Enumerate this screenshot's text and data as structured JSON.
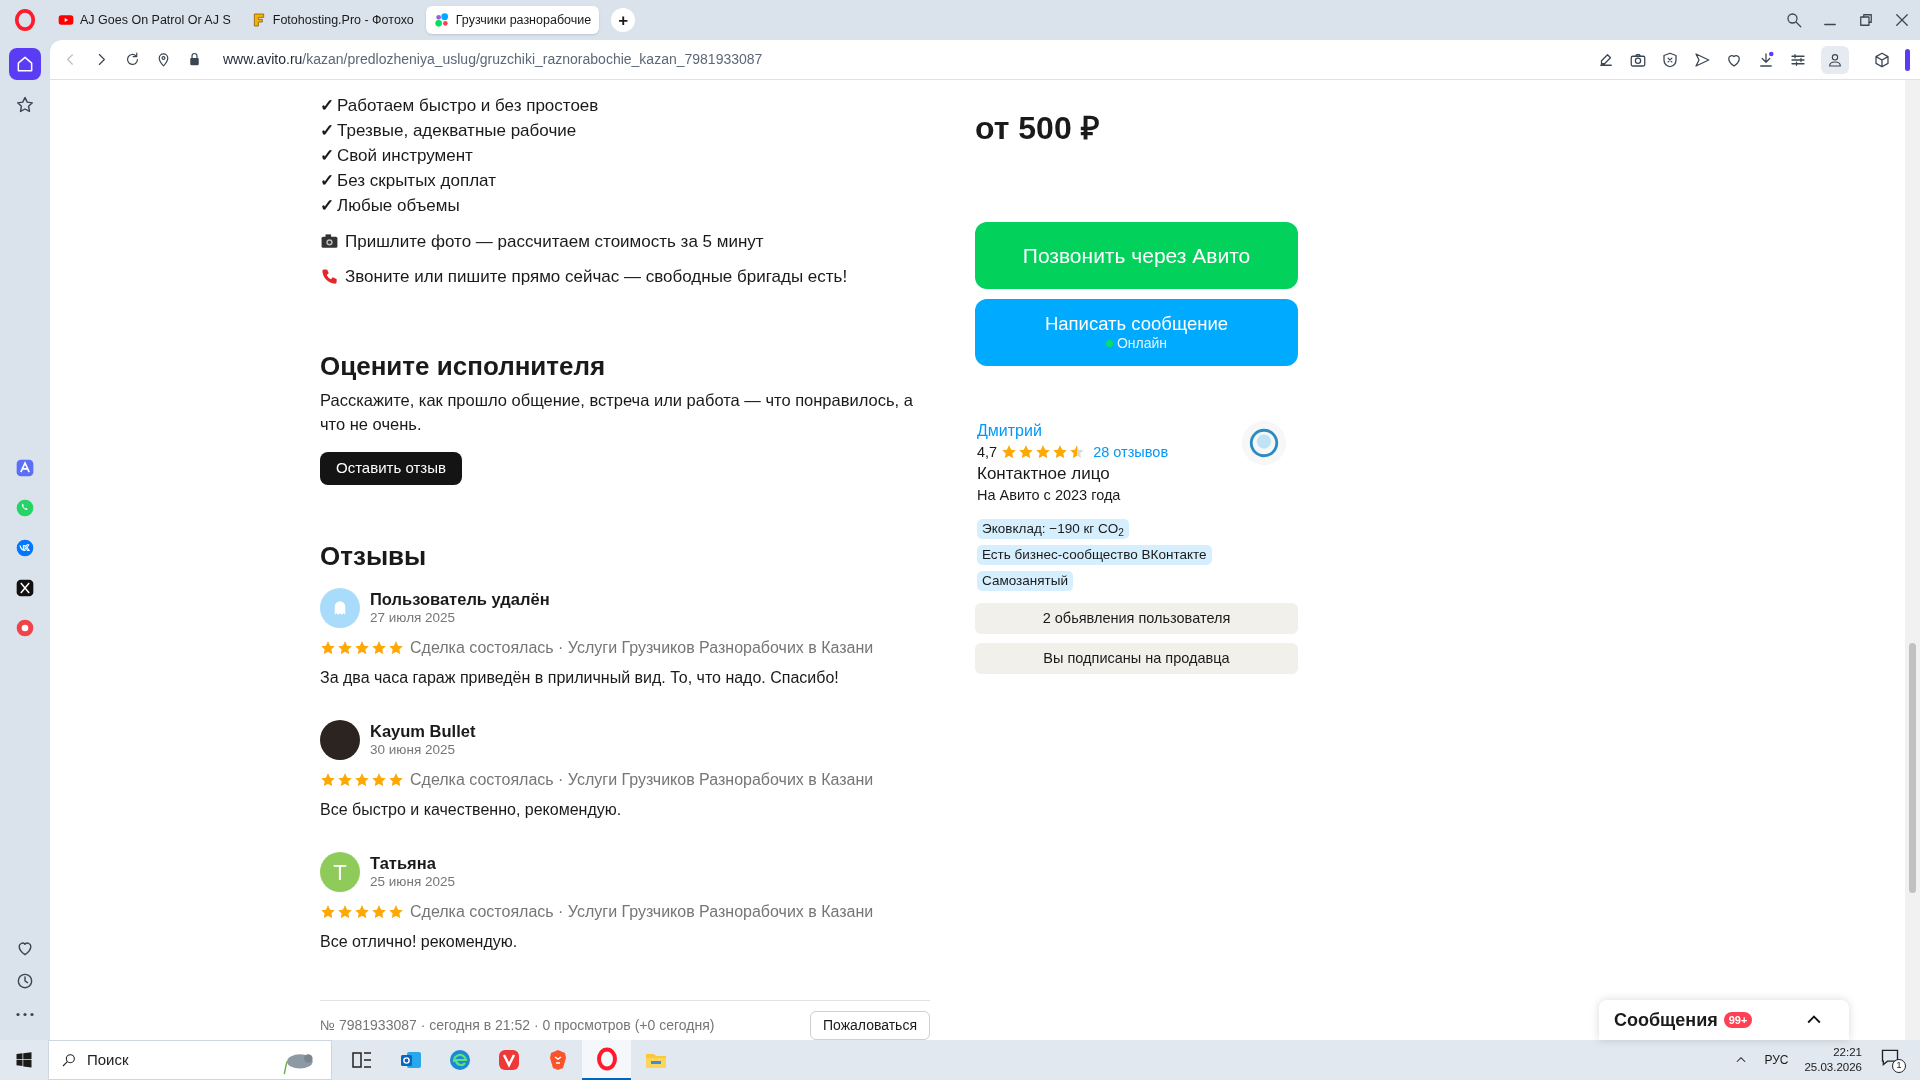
{
  "browser": {
    "tabs": [
      {
        "kind": "youtube",
        "title": "AJ Goes On Patrol Or AJ S",
        "selected": false
      },
      {
        "kind": "fotohosting",
        "title": "Fotohosting.Pro - Фотохо",
        "selected": false
      },
      {
        "kind": "avito",
        "title": "Грузчики разнорабочие",
        "selected": true
      }
    ],
    "new_tab": "+",
    "url_host": "www.avito.ru",
    "url_path": "/kazan/predlozheniya_uslug/gruzchiki_raznorabochie_kazan_7981933087"
  },
  "sidebar": {
    "top": [
      {
        "kind": "home",
        "selected": true
      },
      {
        "kind": "star",
        "selected": false
      }
    ],
    "apps": [
      {
        "kind": "aria",
        "selected": false
      },
      {
        "kind": "whatsapp",
        "selected": false
      },
      {
        "kind": "vk",
        "selected": false
      },
      {
        "kind": "x",
        "selected": false
      },
      {
        "kind": "music",
        "selected": false
      }
    ],
    "bottom": [
      {
        "kind": "heart",
        "selected": false
      },
      {
        "kind": "history",
        "selected": false
      },
      {
        "kind": "more",
        "selected": false
      }
    ]
  },
  "description": {
    "checks": [
      {
        "mark": "✓",
        "text": "Работаем быстро и без простоев"
      },
      {
        "mark": "✓",
        "text": "Трезвые, адекватные рабочие"
      },
      {
        "mark": "✓",
        "text": "Свой инструмент"
      },
      {
        "mark": "✓",
        "text": "Без скрытых доплат"
      },
      {
        "mark": "✓",
        "text": "Любые объемы"
      }
    ],
    "notes": [
      {
        "kind": "camera",
        "text": "Пришлите фото — рассчитаем стоимость за 5 минут"
      },
      {
        "kind": "phone",
        "text": "Звоните или пишите прямо сейчас — свободные бригады есть!"
      }
    ]
  },
  "rate": {
    "title": "Оцените исполнителя",
    "text": "Расскажите, как прошло общение, встреча или работа — что понравилось, а что не очень.",
    "button": "Оставить отзыв"
  },
  "reviews": {
    "title": "Отзывы",
    "items": [
      {
        "author": "Пользователь удалён",
        "date": "27 июля 2025",
        "avatar": {
          "kind": "ghost",
          "color": "#a8dcfa"
        },
        "stars": 5,
        "deal": "Сделка состоялась · Услуги Грузчиков Разнорабочих в Казани",
        "text": "За два часа гараж приведён в приличный вид. То, что надо. Спасибо!"
      },
      {
        "author": "Kayum Bullet",
        "date": "30 июня 2025",
        "avatar": {
          "kind": "photo",
          "color": "#2b2420"
        },
        "stars": 5,
        "deal": "Сделка состоялась · Услуги Грузчиков Разнорабочих в Казани",
        "text": "Все быстро и качественно, рекомендую."
      },
      {
        "author": "Татьяна",
        "date": "25 июня 2025",
        "avatar": {
          "kind": "letter",
          "letter": "Т",
          "color": "#8fcb5b"
        },
        "stars": 5,
        "deal": "Сделка состоялась · Услуги Грузчиков Разнорабочих в Казани",
        "text": "Все отлично! рекомендую."
      }
    ]
  },
  "footer": {
    "meta": "№ 7981933087 · сегодня в 21:52 · 0 просмотров (+0 сегодня)",
    "report": "Пожаловаться"
  },
  "offer": {
    "price": "от 500 ₽",
    "call_button": "Позвонить через Авито",
    "message_button": "Написать сообщение",
    "online": "Онлайн",
    "seller": {
      "name": "Дмитрий",
      "rating": "4,7",
      "stars": 4.5,
      "reviews_link": "28 отзывов",
      "role": "Контактное лицо",
      "since": "На Авито с 2023 года"
    },
    "badges": [
      "Эковклад: −190 кг CO$_{2}$",
      "Есть бизнес-сообщество ВКонтакте",
      "Самозанятый"
    ],
    "buttons": [
      "2 обьявления пользователя",
      "Вы подписаны на продавца"
    ]
  },
  "messages_widget": {
    "title": "Сообщения",
    "badge": "99+"
  },
  "taskbar": {
    "search_placeholder": "Поиск",
    "apps": [
      {
        "kind": "taskview",
        "selected": false
      },
      {
        "kind": "outlook",
        "selected": false
      },
      {
        "kind": "edge",
        "selected": false
      },
      {
        "kind": "vivaldi",
        "selected": false
      },
      {
        "kind": "brave",
        "selected": false
      },
      {
        "kind": "opera",
        "selected": true
      },
      {
        "kind": "explorer",
        "selected": false
      }
    ],
    "language": "РУС",
    "time": "22:21",
    "date": "25.03.2026",
    "notifications": "1"
  }
}
